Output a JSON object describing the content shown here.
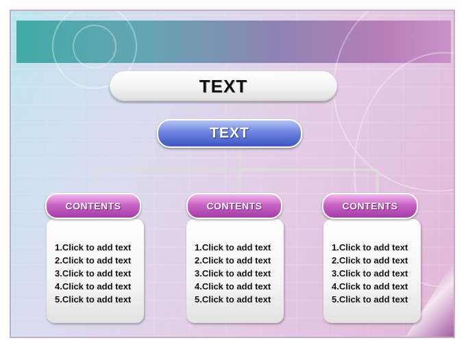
{
  "title": "TEXT",
  "subtitle": "TEXT",
  "columns": [
    {
      "heading": "CONTENTS",
      "items": [
        "1.Click to add text",
        "2.Click to add text",
        "3.Click to add text",
        "4.Click to add text",
        "5.Click to add text"
      ]
    },
    {
      "heading": "CONTENTS",
      "items": [
        "1.Click to add text",
        "2.Click to add text",
        "3.Click to add text",
        "4.Click to add text",
        "5.Click to add text"
      ]
    },
    {
      "heading": "CONTENTS",
      "items": [
        "1.Click to add text",
        "2.Click to add text",
        "3.Click to add text",
        "4.Click to add text",
        "5.Click to add text"
      ]
    }
  ],
  "colors": {
    "band_start": "#3ca7a3",
    "band_end": "#c890c8",
    "subtitle_pill": "#3d55c6",
    "contents_pill": "#a23ca8",
    "connector": "#d8d8d8"
  }
}
